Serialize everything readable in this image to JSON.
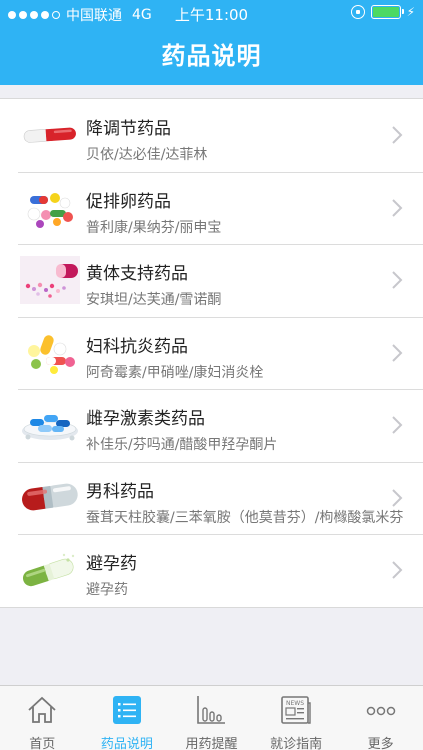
{
  "statusbar": {
    "carrier": "中国联通",
    "network": "4G",
    "time": "上午11:00",
    "signal_dots_filled": 4,
    "battery_level": 1.0
  },
  "header": {
    "title": "药品说明",
    "color": "#2fb3f4"
  },
  "list": {
    "items": [
      {
        "title": "降调节药品",
        "subtitle": "贝依/达必佳/达菲林",
        "icon": "white-red-capsule"
      },
      {
        "title": "促排卵药品",
        "subtitle": "普利康/果纳芬/丽申宝",
        "icon": "colorful-pills"
      },
      {
        "title": "黄体支持药品",
        "subtitle": "安琪坦/达芙通/雪诺酮",
        "icon": "pink-pills-capsule"
      },
      {
        "title": "妇科抗炎药品",
        "subtitle": "阿奇霉素/甲硝唑/康妇消炎栓",
        "icon": "yellow-green-pills"
      },
      {
        "title": "雌孕激素类药品",
        "subtitle": "补佳乐/芬吗通/醋酸甲羟孕酮片",
        "icon": "blue-pills-tray"
      },
      {
        "title": "男科药品",
        "subtitle": "蚕茸天柱胶囊/三苯氧胺（他莫昔芬）/枸橼酸氯米芬",
        "icon": "red-silver-capsule"
      },
      {
        "title": "避孕药",
        "subtitle": "避孕药",
        "icon": "green-capsule"
      }
    ]
  },
  "tabbar": {
    "active_color": "#2fb3f4",
    "tabs": [
      {
        "label": "首页",
        "icon": "home-icon"
      },
      {
        "label": "药品说明",
        "icon": "list-icon",
        "active": true
      },
      {
        "label": "用药提醒",
        "icon": "bar-chart-icon"
      },
      {
        "label": "就诊指南",
        "icon": "news-icon"
      },
      {
        "label": "更多",
        "icon": "more-icon"
      }
    ]
  }
}
